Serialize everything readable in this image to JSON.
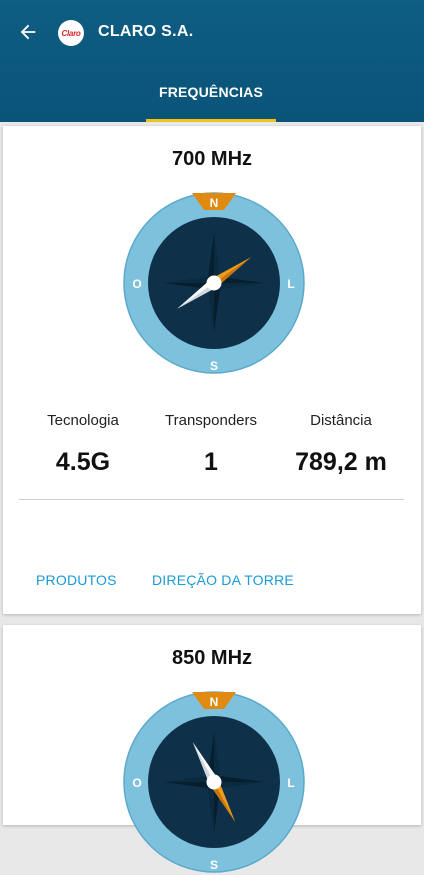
{
  "appbar": {
    "title": "CLARO S.A.",
    "logo_text": "Claro",
    "back_icon": "arrow-left-icon",
    "colors": {
      "background": "#0e5d82",
      "tab_indicator": "#f2c21b"
    }
  },
  "tabs": [
    {
      "label": "FREQUÊNCIAS",
      "selected": true
    }
  ],
  "cards": [
    {
      "frequency": "700 MHz",
      "compass": {
        "north": "N",
        "south": "S",
        "east": "L",
        "west": "O",
        "needle_heading_deg": 55
      },
      "stats": [
        {
          "label": "Tecnologia",
          "value": "4.5G"
        },
        {
          "label": "Transponders",
          "value": "1"
        },
        {
          "label": "Distância",
          "value": "789,2 m"
        }
      ],
      "actions": [
        "PRODUTOS",
        "DIREÇÃO DA TORRE"
      ]
    },
    {
      "frequency": "850 MHz",
      "compass": {
        "north": "N",
        "south": "S",
        "east": "L",
        "west": "O",
        "needle_heading_deg": 152
      }
    }
  ],
  "colors": {
    "compass_ring": "#7ec1dc",
    "compass_face": "#0e3149",
    "north_marker": "#e08a12",
    "needle_orange": "#f29b1c",
    "action_text": "#1a9ad6"
  }
}
